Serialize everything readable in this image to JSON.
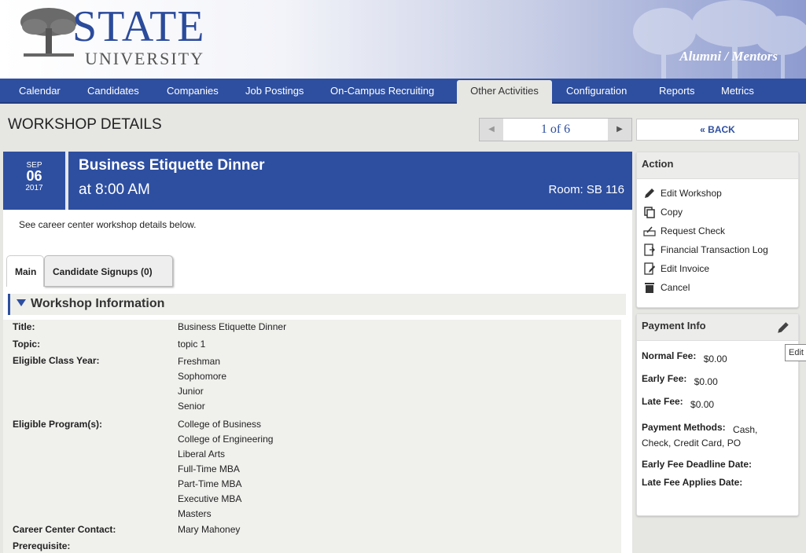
{
  "header": {
    "logo_main": "STATE",
    "logo_sub": "UNIVERSITY",
    "portal_title": "Alumni / Mentors"
  },
  "nav": {
    "items": [
      "Calendar",
      "Candidates",
      "Companies",
      "Job Postings",
      "On-Campus Recruiting",
      "Other Activities",
      "Configuration",
      "Reports",
      "Metrics"
    ],
    "active": "Other Activities"
  },
  "page": {
    "title": "WORKSHOP DETAILS",
    "pager_text": "1 of 6",
    "back_label": "« BACK"
  },
  "event": {
    "month": "SEP",
    "day": "06",
    "year": "2017",
    "name": "Business Etiquette Dinner",
    "time": "at 8:00 AM",
    "room": "Room:  SB 116"
  },
  "main": {
    "intro": "See career center workshop details below.",
    "tabs": [
      "Main",
      "Candidate Signups (0)"
    ],
    "section_title": "Workshop Information",
    "fields": {
      "title_label": "Title:",
      "title_value": "Business Etiquette Dinner",
      "topic_label": "Topic:",
      "topic_value": "topic 1",
      "class_year_label": "Eligible Class Year:",
      "class_years": [
        "Freshman",
        "Sophomore",
        "Junior",
        "Senior"
      ],
      "programs_label": "Eligible Program(s):",
      "programs": [
        "College of Business",
        "College of Engineering",
        "Liberal Arts",
        "Full-Time MBA",
        "Part-Time MBA",
        "Executive MBA",
        "Masters"
      ],
      "contact_label": "Career Center Contact:",
      "contact_value": "Mary Mahoney",
      "prereq_label": "Prerequisite:"
    }
  },
  "action_panel": {
    "title": "Action",
    "items": [
      {
        "label": "Edit Workshop",
        "icon": "pencil-icon"
      },
      {
        "label": "Copy",
        "icon": "copy-icon"
      },
      {
        "label": "Request Check",
        "icon": "request-check-icon"
      },
      {
        "label": "Financial Transaction Log",
        "icon": "transaction-log-icon"
      },
      {
        "label": "Edit Invoice",
        "icon": "edit-invoice-icon"
      },
      {
        "label": "Cancel",
        "icon": "trash-icon"
      }
    ]
  },
  "payment_panel": {
    "title": "Payment Info",
    "normal_fee_label": "Normal Fee:",
    "normal_fee": "$0.00",
    "early_fee_label": "Early Fee:",
    "early_fee": "$0.00",
    "late_fee_label": "Late Fee:",
    "late_fee": "$0.00",
    "methods_label": "Payment Methods:",
    "methods_line1": "Cash,",
    "methods_line2": "Check, Credit Card, PO",
    "early_deadline_label": "Early Fee Deadline Date:",
    "late_applies_label": "Late Fee Applies Date:",
    "tooltip": "Edit"
  },
  "colors": {
    "brand_blue": "#2e4fa0",
    "background": "#e6e6e3"
  }
}
